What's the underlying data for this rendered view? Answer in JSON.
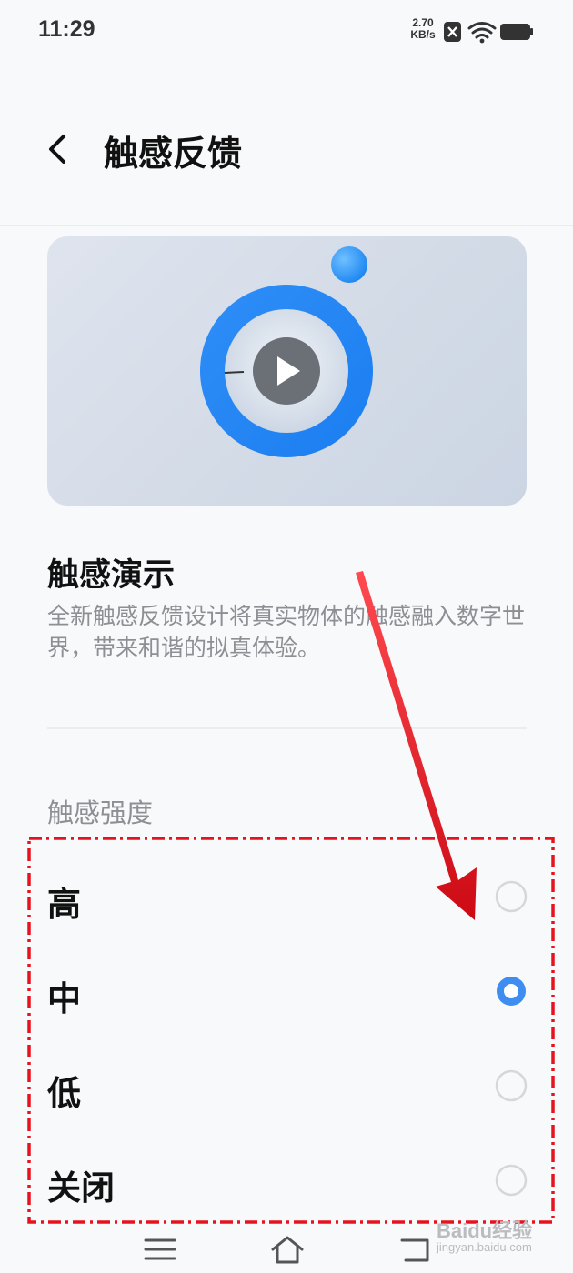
{
  "status_bar": {
    "time": "11:29",
    "speed_value": "2.70",
    "speed_unit": "KB/s",
    "icons": [
      "sim-x-icon",
      "wifi-icon",
      "battery-icon"
    ]
  },
  "header": {
    "title": "触感反馈",
    "back_icon": "chevron-left-icon"
  },
  "demo": {
    "icon": "play-icon",
    "title": "触感演示",
    "description": "全新触感反馈设计将真实物体的触感融入数字世界，带来和谐的拟真体验。"
  },
  "intensity": {
    "label": "触感强度",
    "options": [
      {
        "label": "高",
        "selected": false
      },
      {
        "label": "中",
        "selected": true
      },
      {
        "label": "低",
        "selected": false
      },
      {
        "label": "关闭",
        "selected": false
      }
    ]
  },
  "nav_bar": {
    "icons": [
      "menu-icon",
      "home-icon",
      "back-icon"
    ]
  },
  "watermark": {
    "main": "Baidu经验",
    "sub": "jingyan.baidu.com"
  },
  "colors": {
    "accent": "#3d8ef0",
    "annotation": "#e8121e",
    "background": "#f8f9fa"
  }
}
